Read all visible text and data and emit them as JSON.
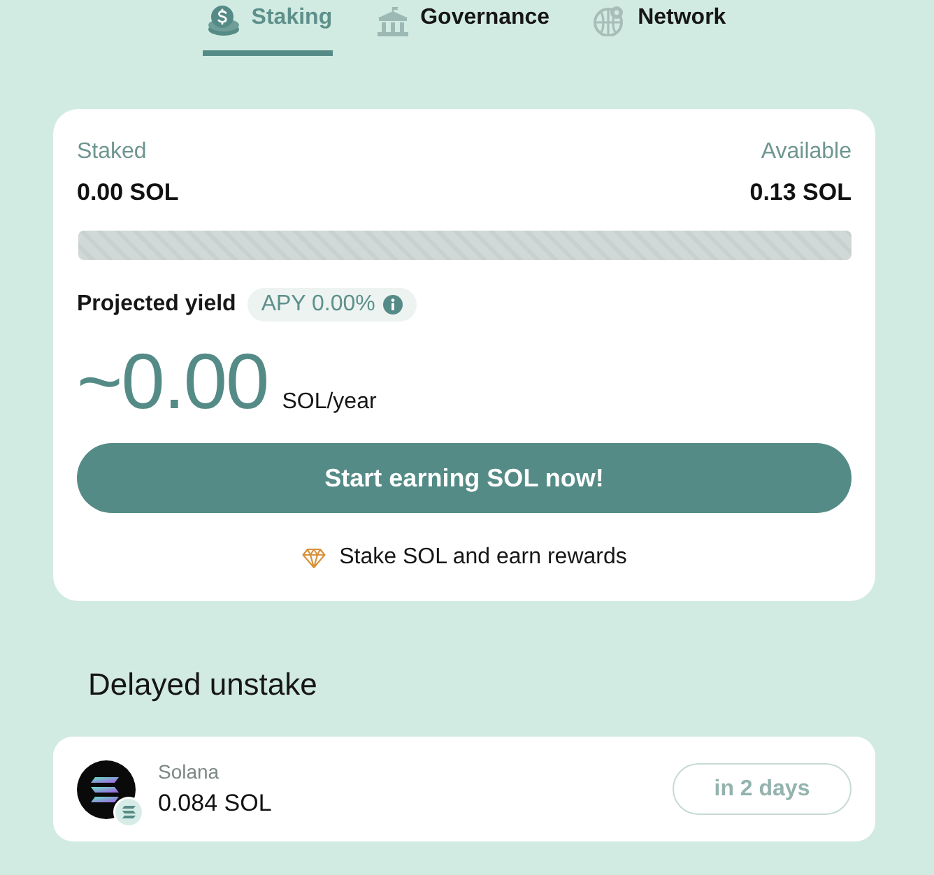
{
  "tabs": [
    {
      "label": "Staking",
      "selected": true
    },
    {
      "label": "Governance",
      "selected": false
    },
    {
      "label": "Network",
      "selected": false
    }
  ],
  "staking_card": {
    "staked": {
      "label": "Staked",
      "value": "0.00 SOL"
    },
    "available": {
      "label": "Available",
      "value": "0.13 SOL"
    },
    "projected_yield": {
      "label": "Projected yield",
      "apy": "APY 0.00%"
    },
    "yield_amount": "~0.00",
    "yield_unit": "SOL/year",
    "action_button": "Start earning SOL now!",
    "note": "Stake SOL and earn rewards"
  },
  "delayed_unstake": {
    "title": "Delayed unstake",
    "items": [
      {
        "token": "Solana",
        "amount": "0.084 SOL",
        "button": {
          "label": "in 2 days",
          "disabled": true
        }
      }
    ]
  }
}
